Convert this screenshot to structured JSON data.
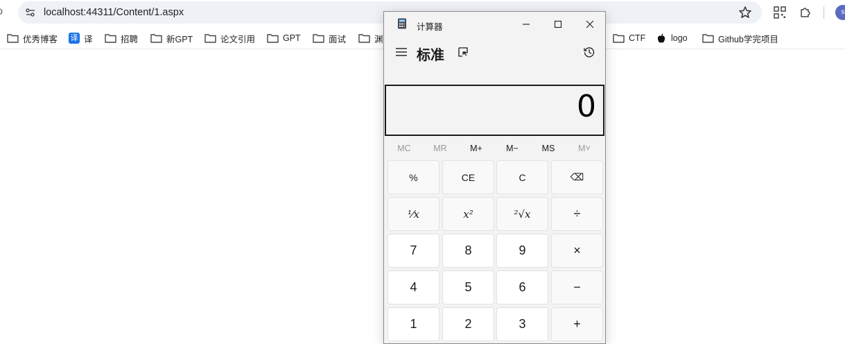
{
  "browser": {
    "back_fragment": "ɔ",
    "url": "localhost:44311/Content/1.aspx",
    "profile_initial": "s"
  },
  "bookmarks": [
    {
      "label": "优秀博客",
      "icon": "folder-icon"
    },
    {
      "label": "译",
      "icon": "translate-icon"
    },
    {
      "label": "招聘",
      "icon": "folder-icon"
    },
    {
      "label": "新GPT",
      "icon": "folder-icon"
    },
    {
      "label": "论文引用",
      "icon": "folder-icon"
    },
    {
      "label": "GPT",
      "icon": "folder-icon"
    },
    {
      "label": "面试",
      "icon": "folder-icon"
    },
    {
      "label": "渊",
      "icon": "folder-icon"
    },
    {
      "label": "CTF",
      "icon": "folder-icon"
    },
    {
      "label": "logo",
      "icon": "apple-icon"
    },
    {
      "label": "Github学完项目",
      "icon": "folder-icon"
    }
  ],
  "calculator": {
    "window_title": "计算器",
    "mode_title": "标准",
    "display_value": "0",
    "memory": [
      {
        "label": "MC",
        "enabled": false
      },
      {
        "label": "MR",
        "enabled": false
      },
      {
        "label": "M+",
        "enabled": true
      },
      {
        "label": "M−",
        "enabled": true
      },
      {
        "label": "MS",
        "enabled": true
      },
      {
        "label": "M˅",
        "enabled": false
      }
    ],
    "keys": {
      "percent": "%",
      "ce": "CE",
      "c": "C",
      "backspace": "⌫",
      "reciprocal": "¹⁄x",
      "square": "x²",
      "sqrt": "²√x",
      "divide": "÷",
      "seven": "7",
      "eight": "8",
      "nine": "9",
      "multiply": "×",
      "four": "4",
      "five": "5",
      "six": "6",
      "minus": "−",
      "one": "1",
      "two": "2",
      "three": "3",
      "plus": "+"
    }
  },
  "colors": {
    "accent_blue": "#1a73e8",
    "calc_bg": "#f3f3f3",
    "key_number_bg": "#ffffff",
    "key_op_bg": "#f9f9f9"
  }
}
